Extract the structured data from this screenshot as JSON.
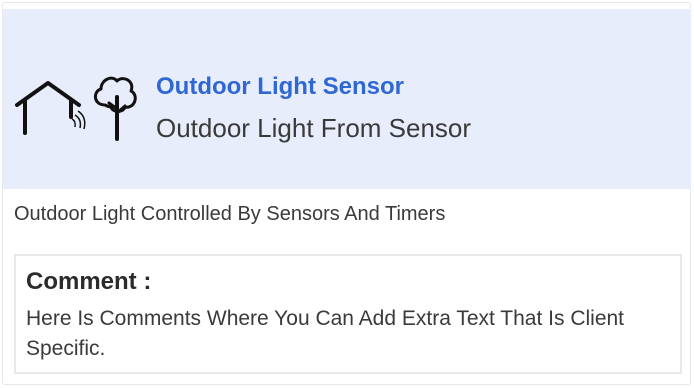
{
  "header": {
    "title": "Outdoor Light Sensor",
    "subtitle": "Outdoor Light From Sensor",
    "icons": [
      "house-sensor-icon",
      "tree-icon"
    ],
    "background_color": "#e8edfb",
    "title_color": "#2f67d3"
  },
  "description": "Outdoor Light Controlled By Sensors And Timers",
  "comment": {
    "heading": "Comment :",
    "text": "Here Is Comments Where You Can Add Extra Text That Is Client Specific."
  }
}
